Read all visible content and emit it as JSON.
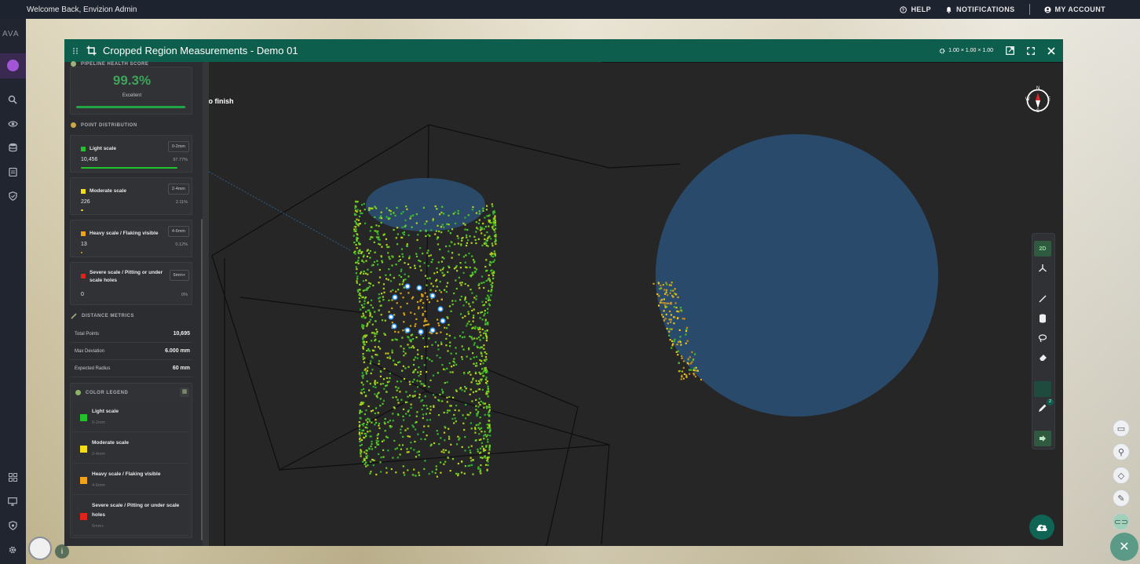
{
  "topbar": {
    "welcome": "Welcome Back, Envizion Admin",
    "help": "HELP",
    "notifications": "NOTIFICATIONS",
    "account": "MY ACCOUNT"
  },
  "rail": {
    "brand": "AVA"
  },
  "modal": {
    "title": "Cropped Region Measurements - Demo 01",
    "scale_chip": "1.00 × 1.00 × 1.00"
  },
  "panel": {
    "health": {
      "label": "PIPELINE HEALTH SCORE",
      "score": "99.3%",
      "rating": "Excellent",
      "fraction": 0.993
    },
    "point_distribution": {
      "label": "POINT DISTRIBUTION",
      "items": [
        {
          "name": "Light scale",
          "range": "0-2mm",
          "count": "10,456",
          "pct": "97.77%",
          "color": "#22c32a",
          "fraction": 0.9777
        },
        {
          "name": "Moderate scale",
          "range": "2-4mm",
          "count": "226",
          "pct": "2.11%",
          "color": "#f2dd16",
          "fraction": 0.0211
        },
        {
          "name": "Heavy scale / Flaking visible",
          "range": "4-6mm",
          "count": "13",
          "pct": "0.12%",
          "color": "#f0a21a",
          "fraction": 0.0012
        },
        {
          "name": "Severe scale / Pitting or under scale holes",
          "range": "6mm+",
          "count": "0",
          "pct": "0%",
          "color": "#e0241c",
          "fraction": 0
        }
      ]
    },
    "distance_metrics": {
      "label": "DISTANCE METRICS",
      "rows": [
        {
          "label": "Total Points",
          "value": "10,695"
        },
        {
          "label": "Max Deviation",
          "value": "6.000 mm"
        },
        {
          "label": "Expected Radius",
          "value": "60 mm"
        }
      ]
    },
    "color_legend": {
      "label": "COLOR LEGEND",
      "items": [
        {
          "name": "Light scale",
          "range": "0-2mm",
          "color": "#22c32a"
        },
        {
          "name": "Moderate scale",
          "range": "2-4mm",
          "color": "#f2dd16"
        },
        {
          "name": "Heavy scale / Flaking visible",
          "range": "4-6mm",
          "color": "#f0a21a"
        },
        {
          "name": "Severe scale / Pitting or under scale holes",
          "range": "6mm+",
          "color": "#e0241c"
        }
      ]
    }
  },
  "viewport": {
    "hint": "Double-click, press Enter, or right-click to finish",
    "compass": {
      "n": "N",
      "s": "S",
      "e": "E",
      "w": "W"
    },
    "toolbar": {
      "view_2d": "2D",
      "badge_count": "2"
    }
  },
  "colors": {
    "accent": "#0e5e4d",
    "sphere": "#2a4a6b",
    "nav_active": "#a255d9"
  }
}
